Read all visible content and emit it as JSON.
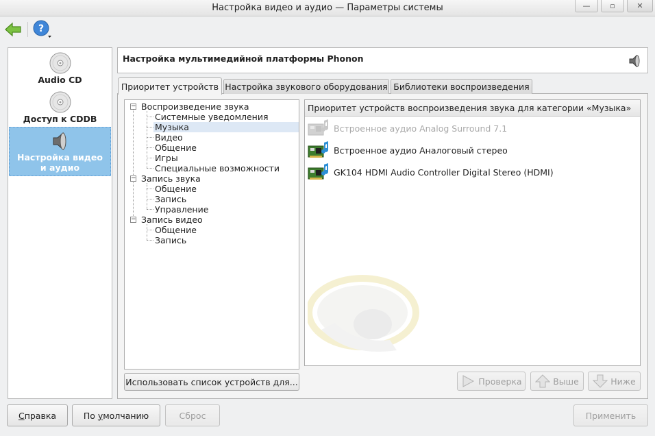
{
  "window": {
    "title": "Настройка видео и аудио — Параметры системы",
    "controls": {
      "minimize": "—",
      "maximize": "▫",
      "close": "✕"
    }
  },
  "toolbar": {
    "back_icon": "back-arrow-icon",
    "help_icon": "help-icon"
  },
  "sidebar": {
    "items": [
      {
        "label": "Audio CD",
        "icon": "cd-icon",
        "active": false
      },
      {
        "label": "Доступ к CDDB",
        "icon": "cd-icon",
        "active": false
      },
      {
        "label_line1": "Настройка видео",
        "label_line2": "и аудио",
        "icon": "speaker-icon",
        "active": true
      }
    ]
  },
  "header": {
    "title": "Настройка мультимедийной платформы Phonon",
    "icon": "speaker-icon"
  },
  "tabs": [
    {
      "label": "Приоритет устройств",
      "active": true
    },
    {
      "label": "Настройка звукового оборудования",
      "active": false
    },
    {
      "label": "Библиотеки воспроизведения",
      "active": false
    }
  ],
  "tree": {
    "groups": [
      {
        "label": "Воспроизведение звука",
        "expander": "−",
        "children": [
          "Системные уведомления",
          "Музыка",
          "Видео",
          "Общение",
          "Игры",
          "Специальные возможности"
        ]
      },
      {
        "label": "Запись звука",
        "expander": "−",
        "children": [
          "Общение",
          "Запись",
          "Управление"
        ]
      },
      {
        "label": "Запись видео",
        "expander": "−",
        "children": [
          "Общение",
          "Запись"
        ]
      }
    ],
    "selected": "Музыка"
  },
  "devices": {
    "header": "Приоритет устройств воспроизведения звука для категории «Музыка»",
    "items": [
      {
        "label": "Встроенное аудио Analog Surround 7.1",
        "disabled": true,
        "icon": "sound-card-icon"
      },
      {
        "label": "Встроенное аудио Аналоговый стерео",
        "disabled": false,
        "icon": "sound-card-icon"
      },
      {
        "label": "GK104 HDMI Audio Controller Digital Stereo (HDMI)",
        "disabled": false,
        "icon": "sound-card-icon"
      }
    ]
  },
  "buttons": {
    "use_device_list": "Использовать список устройств для...",
    "test": "Проверка",
    "up": "Выше",
    "down": "Ниже",
    "help_pre": "",
    "help_u": "С",
    "help_post": "правка",
    "defaults_pre": "По ",
    "defaults_u": "у",
    "defaults_post": "молчанию",
    "reset": "Сброс",
    "apply": "Применить"
  },
  "colors": {
    "selection": "#8fc4ea",
    "tree_selection": "#dde8f5",
    "window_bg": "#eff0f1"
  }
}
